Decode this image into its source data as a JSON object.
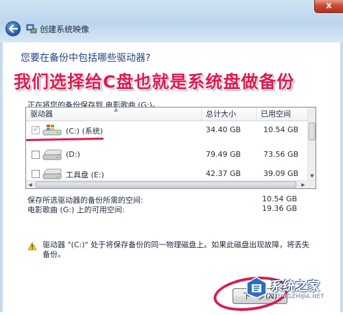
{
  "window": {
    "close_label": "x",
    "nav_title": "创建系统映像"
  },
  "main": {
    "heading": "您要在备份中包括哪些驱动器?",
    "overlay_caption": "我们选择给C盘也就是系统盘做备份",
    "save_to": "正在将您的备份保存到 电影歌曲 (G:)。"
  },
  "table": {
    "columns": [
      "驱动器",
      "总计大小",
      "已用空间"
    ],
    "rows": [
      {
        "name": "(C:) (系统)",
        "total": "34.40 GB",
        "used": "10.54 GB",
        "checked": true,
        "icon": "windows-drive-icon"
      },
      {
        "name": "(D:)",
        "total": "79.49 GB",
        "used": "73.56 GB",
        "checked": false,
        "icon": "hard-drive-icon"
      },
      {
        "name": "工具盘 (E:)",
        "total": "42.37 GB",
        "used": "39.09 GB",
        "checked": false,
        "icon": "hard-drive-icon"
      }
    ]
  },
  "summary": {
    "required_label": "保存所选驱动器的备份所需的空间:",
    "required_value": "10.54 GB",
    "available_label": "电影歌曲 (G:) 上的可用空间:",
    "available_value": "19.36 GB"
  },
  "warning": {
    "text": "驱动器 \"(C:)\" 处于将保存备份的同一物理磁盘上。如果此磁盘出现故障，将丢失备份。"
  },
  "footer": {
    "next_label": "下一步(N)",
    "watermark": "系统之家",
    "watermark_url": "XITONGZHIJIA.NET"
  },
  "colors": {
    "accent": "#d81c4e",
    "heading": "#1f3f82",
    "title_band": "#c5daee"
  }
}
